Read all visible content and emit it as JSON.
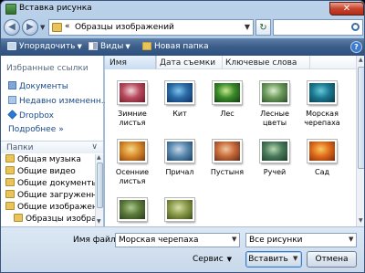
{
  "window": {
    "title": "Вставка рисунка",
    "close_symbol": "✕"
  },
  "nav": {
    "back_symbol": "◀",
    "forward_symbol": "▶",
    "address_prefix": "«",
    "address_path": "Образцы изображений",
    "refresh_symbol": "↻"
  },
  "toolbar": {
    "organize_label": "Упорядочить",
    "views_label": "Виды",
    "new_folder_label": "Новая папка",
    "help_symbol": "?"
  },
  "sidebar": {
    "favorites_heading": "Избранные ссылки",
    "links": [
      {
        "label": "Документы",
        "icon": "documents-icon"
      },
      {
        "label": "Недавно измененн...",
        "icon": "recent-icon"
      },
      {
        "label": "Dropbox",
        "icon": "dropbox-icon"
      }
    ],
    "more_label": "Подробнее",
    "more_symbol": "»",
    "folders_label": "Папки",
    "folders_chevron": "∨",
    "tree": [
      "Общая музыка",
      "Общие видео",
      "Общие документы",
      "Общие загруженны",
      "Общие изображени",
      "Образцы изображ"
    ]
  },
  "columns": {
    "name": "Имя",
    "date_taken": "Дата съемки",
    "keywords": "Ключевые слова"
  },
  "files": [
    {
      "name": "Зимние листья",
      "colors": [
        "#f2d6dc",
        "#b84a5c",
        "#6a1a2a"
      ]
    },
    {
      "name": "Кит",
      "colors": [
        "#7ec4e8",
        "#2a6aa8",
        "#0c3060"
      ]
    },
    {
      "name": "Лес",
      "colors": [
        "#c8e890",
        "#3a8a2a",
        "#123a12"
      ]
    },
    {
      "name": "Лесные цветы",
      "colors": [
        "#dcecd0",
        "#6a9a5a",
        "#2a4a2a"
      ]
    },
    {
      "name": "Морская черепаха",
      "colors": [
        "#6ac8d8",
        "#1a7890",
        "#0a3848"
      ]
    },
    {
      "name": "Осенние листья",
      "colors": [
        "#f4d88a",
        "#d88a2a",
        "#7a3a10"
      ]
    },
    {
      "name": "Причал",
      "colors": [
        "#c8d8e8",
        "#5a8ab0",
        "#1a3a5a"
      ]
    },
    {
      "name": "Пустыня",
      "colors": [
        "#f0c8a0",
        "#c86a3a",
        "#5a2a1a"
      ]
    },
    {
      "name": "Ручей",
      "colors": [
        "#b8d8b0",
        "#4a7a5a",
        "#1a3a2a"
      ]
    },
    {
      "name": "Сад",
      "colors": [
        "#f8c860",
        "#e06a1a",
        "#7a2a0a"
      ]
    },
    {
      "name": "",
      "colors": [
        "#b0c890",
        "#5a7a3a",
        "#2a3a1a"
      ]
    },
    {
      "name": "",
      "colors": [
        "#d8e0a8",
        "#8a9a4a",
        "#3a4a1a"
      ]
    }
  ],
  "bottom": {
    "filename_label": "Имя файла:",
    "filename_value": "Морская черепаха",
    "filetype_value": "Все рисунки",
    "service_label": "Сервис",
    "insert_label": "Вставить",
    "cancel_label": "Отмена",
    "dropdown_symbol": "▼"
  }
}
